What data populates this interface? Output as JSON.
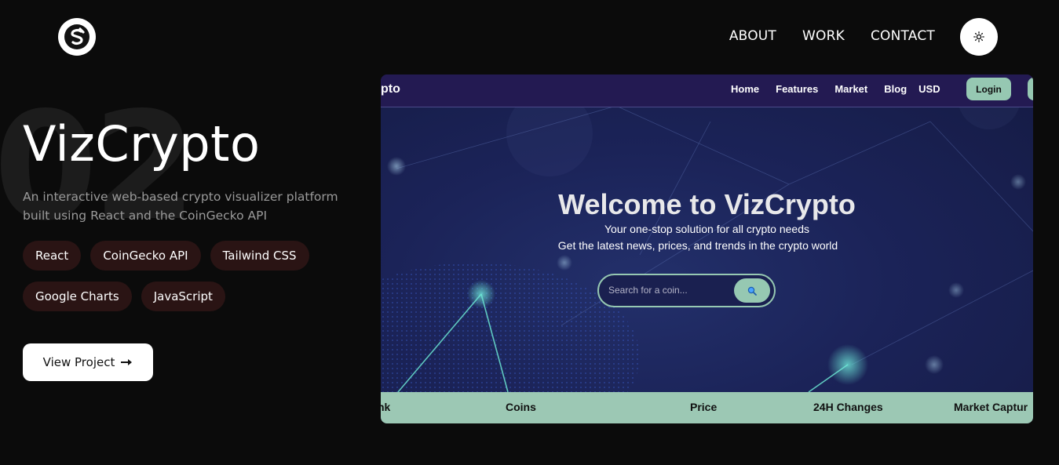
{
  "header": {
    "logo_icon": "svelte-s-logo-icon",
    "nav": [
      "ABOUT",
      "WORK",
      "CONTACT"
    ],
    "theme_icon": "sun-icon"
  },
  "project": {
    "number": "02",
    "title": "VizCrypto",
    "description": "An interactive web-based crypto visualizer platform built using React and the CoinGecko API",
    "tags": [
      "React",
      "CoinGecko API",
      "Tailwind CSS",
      "Google Charts",
      "JavaScript"
    ],
    "view_button": "View Project",
    "view_icon": "arrow-right-icon"
  },
  "preview": {
    "brand": "pto",
    "menu": [
      "Home",
      "Features",
      "Market",
      "Blog",
      "USD"
    ],
    "login": "Login",
    "welcome": "Welcome to VizCrypto",
    "sub1": "Your one-stop solution for all crypto needs",
    "sub2": "Get the latest news, prices, and trends in the crypto world",
    "search_placeholder": "Search for a coin...",
    "search_icon": "magnifier-icon",
    "table_headers": [
      "nk",
      "Coins",
      "Price",
      "24H Changes",
      "Market Captur"
    ]
  },
  "colors": {
    "background": "#0b0b0b",
    "tag_bg": "#2a1414",
    "accent_mint": "#96c8b2",
    "preview_nav": "#231a52"
  }
}
